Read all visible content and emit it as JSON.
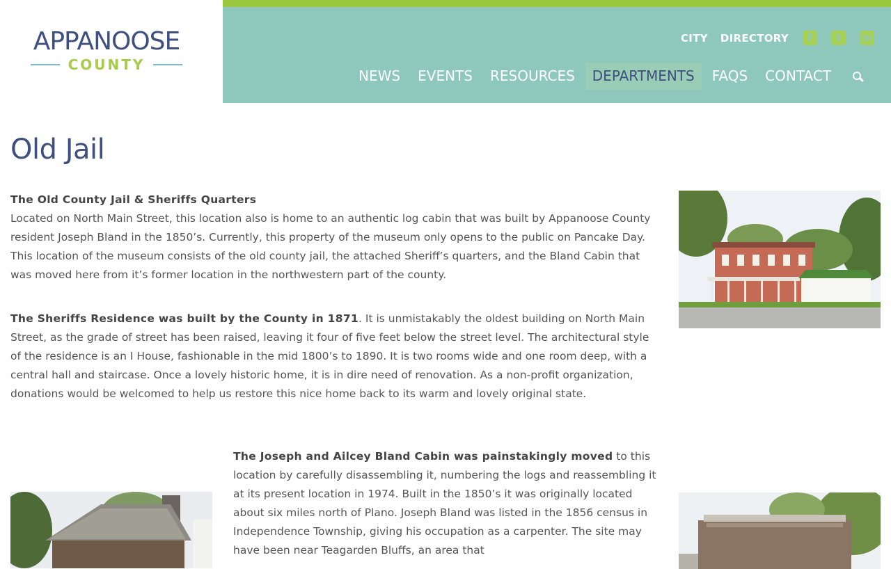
{
  "header": {
    "logo": {
      "main": "APPANOOSE",
      "sub": "COUNTY"
    },
    "utility_links": [
      "CITY",
      "DIRECTORY"
    ],
    "social": [
      {
        "icon": "facebook-icon",
        "glyph": "f"
      },
      {
        "icon": "twitter-icon",
        "glyph": "t"
      },
      {
        "icon": "linkedin-icon",
        "glyph": "in"
      }
    ],
    "nav": [
      "NEWS",
      "EVENTS",
      "RESOURCES",
      "DEPARTMENTS",
      "FAQS",
      "CONTACT"
    ],
    "active_nav": "DEPARTMENTS",
    "colors": {
      "nav_bg": "#8ec8bc",
      "accent_bar": "#9bc83f",
      "active_bg": "#9acdb5",
      "title": "#3f4f80"
    }
  },
  "page": {
    "title": "Old Jail",
    "sections": [
      {
        "heading": "The Old County Jail & Sheriffs Quarters",
        "text": "Located on North Main Street, this location also is home to an authentic log cabin that was built by Appanoose County resident Joseph Bland in the 1850’s. Currently, this property of the museum only opens to the public on Pancake Day. This location of the museum consists of the old county jail, the attached Sheriff’s quarters, and the Bland Cabin that was moved here from it’s former location in the northwestern part of the county."
      },
      {
        "heading": "The Sheriffs Residence was built by the County in 1871",
        "text": ". It is unmistakably the oldest building on North Main Street, as the grade of street has been raised, leaving it four of five feet below the street level. The architectural style of the residence is an I House, fashionable in the mid 1800’s to 1890. It is two rooms wide and one room deep, with a central hall and staircase. Once a lovely historic home, it is in dire need of renovation. As a non-profit organization, donations would be welcomed to help us restore this nice home back to its warm and lovely original state."
      },
      {
        "heading": "The Joseph and Ailcey Bland Cabin was painstakingly moved",
        "text": " to this location by carefully disassembling it, numbering the logs and reassembling it at its present location in 1974. Built in the 1850’s it was originally located about six miles north of Plano. Joseph Bland was listed in the 1856 census in Independence Township, giving his occupation as a carpenter. The site may have been near Teagarden Bluffs, an area that"
      }
    ]
  }
}
